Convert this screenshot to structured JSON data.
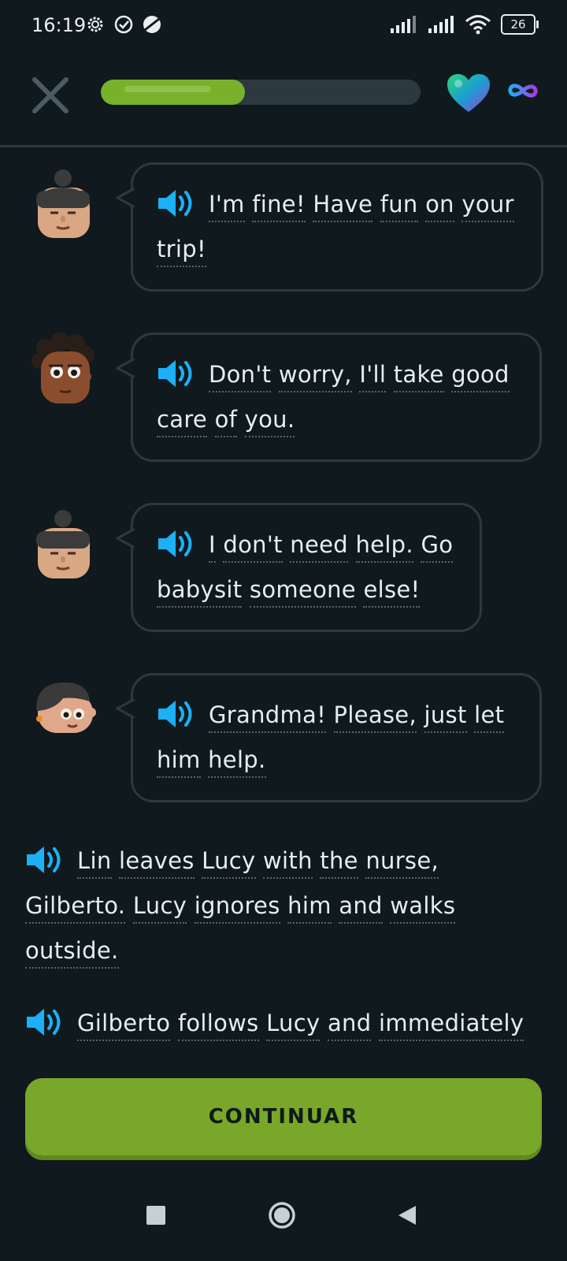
{
  "status_bar": {
    "time": "16:19",
    "battery": "26"
  },
  "lesson": {
    "progress_percent": 45,
    "hearts_label": "∞"
  },
  "dialogue": [
    {
      "speaker": "woman-with-bun",
      "words": [
        "I'm",
        "fine!",
        "Have",
        "fun",
        "on",
        "your"
      ],
      "words2": [
        "trip!"
      ]
    },
    {
      "speaker": "woman-curly-hair",
      "words": [
        "Don't",
        "worry,",
        "I'll",
        "take",
        "good"
      ],
      "words2": [
        "care",
        "of",
        "you."
      ]
    },
    {
      "speaker": "woman-with-bun",
      "words": [
        "I",
        "don't",
        "need",
        "help.",
        "Go"
      ],
      "words2": [
        "babysit",
        "someone",
        "else!"
      ]
    },
    {
      "speaker": "woman-short-hair",
      "words": [
        "Grandma!",
        "Please,",
        "just",
        "let"
      ],
      "words2": [
        "him",
        "help."
      ]
    }
  ],
  "narration": [
    {
      "lines": [
        [
          "Lin",
          "leaves",
          "Lucy",
          "with",
          "the",
          "nurse,"
        ],
        [
          "Gilberto.",
          "Lucy",
          "ignores",
          "him",
          "and",
          "walks"
        ],
        [
          "outside."
        ]
      ]
    },
    {
      "lines": [
        [
          "Gilberto",
          "follows",
          "Lucy",
          "and",
          "immediately"
        ]
      ]
    }
  ],
  "continue_label": "CONTINUAR",
  "colors": {
    "background": "#101a1e",
    "accent_green": "#78a72a",
    "speaker_blue": "#1cb0f6",
    "border": "#2c393f"
  }
}
